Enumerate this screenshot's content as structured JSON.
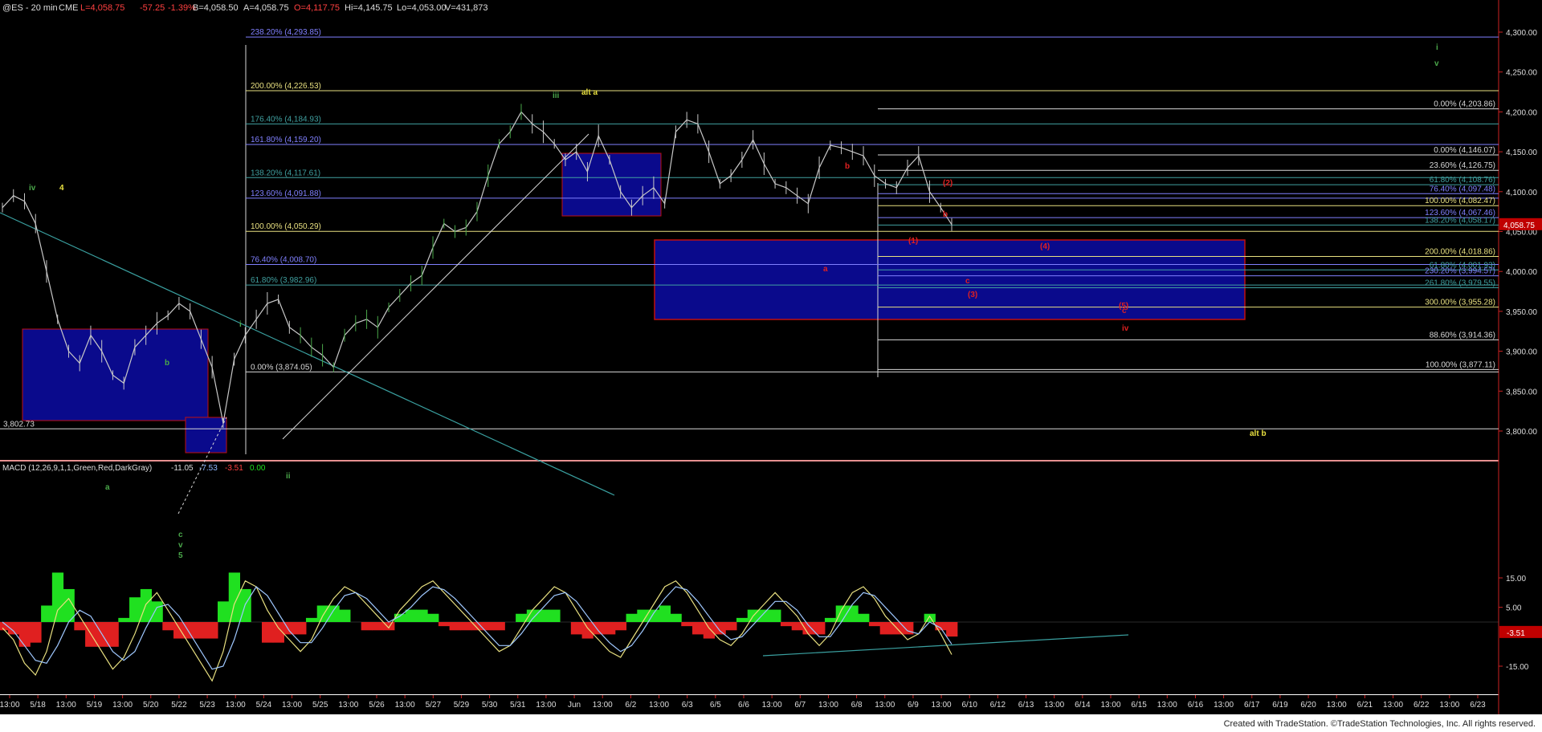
{
  "header": {
    "symbol": "@ES - 20 min",
    "exchange": "CME",
    "last": "L=4,058.75",
    "chg": "-57.25",
    "pct": "-1.39%",
    "bid": "B=4,058.50",
    "ask": "A=4,058.75",
    "open": "O=4,117.75",
    "high": "Hi=4,145.75",
    "low": "Lo=4,053.00",
    "volume": "V=431,873"
  },
  "macd_header": {
    "label": "MACD (12,26,9,1,1,Green,Red,DarkGray)",
    "macd": "-11.05",
    "signal": "-7.53",
    "hist": "-3.51",
    "zero": "0.00"
  },
  "footer": "Created with TradeStation. ©TradeStation Technologies, Inc. All rights reserved.",
  "colors": {
    "background": "#000000",
    "price_bar": "#c8c8c8",
    "up_leg": "#4aa84a",
    "box_fill": "#0a0a8c",
    "box_border_red": "#c01010",
    "fib_yellow": "#e8e080",
    "fib_white": "#d8d8d8",
    "fib_blue": "#8080ff",
    "fib_teal": "#40a0a0",
    "trendline": "#3aa0a0",
    "macd_pos": "#20e020",
    "macd_neg": "#e02020",
    "last_price_box": "#c00000"
  },
  "chart_data": [
    {
      "type": "line",
      "title": "",
      "ylim": [
        3775,
        4335
      ],
      "y_ticks": [
        "4,300.00",
        "4,250.00",
        "4,200.00",
        "4,150.00",
        "4,100.00",
        "4,050.00",
        "4,000.00",
        "3,950.00",
        "3,900.00",
        "3,850.00",
        "3,800.00"
      ],
      "y_tick_values": [
        4300,
        4250,
        4200,
        4150,
        4100,
        4050,
        4000,
        3950,
        3900,
        3850,
        3800
      ],
      "last_price": "4,058.75",
      "last_price_value": 4058.75,
      "x_labels": [
        "13:00",
        "5/18",
        "13:00",
        "5/19",
        "13:00",
        "5/20",
        "5/22",
        "5/23",
        "13:00",
        "5/24",
        "13:00",
        "5/25",
        "13:00",
        "5/26",
        "13:00",
        "5/27",
        "5/29",
        "5/30",
        "5/31",
        "13:00",
        "Jun",
        "13:00",
        "6/2",
        "13:00",
        "6/3",
        "6/5",
        "6/6",
        "13:00",
        "6/7",
        "13:00",
        "6/8",
        "13:00",
        "6/9",
        "13:00",
        "6/10",
        "6/12",
        "6/13",
        "13:00",
        "6/14",
        "13:00",
        "6/15",
        "13:00",
        "6/16",
        "13:00",
        "6/17",
        "6/19",
        "6/20",
        "13:00",
        "6/21",
        "13:00",
        "6/22",
        "13:00",
        "6/23"
      ],
      "series": [
        {
          "values": [
            4080,
            4095,
            4088,
            4060,
            4000,
            3940,
            3900,
            3885,
            3920,
            3900,
            3870,
            3860,
            3905,
            3920,
            3935,
            3945,
            3960,
            3950,
            3915,
            3880,
            3810,
            3890,
            3920,
            3940,
            3960,
            3965,
            3930,
            3920,
            3905,
            3895,
            3880,
            3920,
            3935,
            3940,
            3930,
            3955,
            3970,
            3985,
            3995,
            4030,
            4060,
            4050,
            4055,
            4075,
            4120,
            4160,
            4175,
            4200,
            4185,
            4175,
            4160,
            4140,
            4150,
            4125,
            4170,
            4140,
            4100,
            4080,
            4095,
            4105,
            4085,
            4175,
            4190,
            4185,
            4150,
            4110,
            4120,
            4140,
            4165,
            4135,
            4110,
            4105,
            4095,
            4085,
            4130,
            4158,
            4155,
            4150,
            4145,
            4120,
            4110,
            4105,
            4130,
            4145,
            4100,
            4080,
            4058.75
          ]
        }
      ],
      "fib_levels": [
        {
          "label": "238.20% (4,293.85)",
          "value": 4293.85,
          "color": "#8080ff",
          "side": "left"
        },
        {
          "label": "200.00% (4,226.53)",
          "value": 4226.53,
          "color": "#e8e080",
          "side": "left"
        },
        {
          "label": "176.40% (4,184.93)",
          "value": 4184.93,
          "color": "#40a0a0",
          "side": "left"
        },
        {
          "label": "161.80% (4,159.20)",
          "value": 4159.2,
          "color": "#8080ff",
          "side": "left"
        },
        {
          "label": "138.20% (4,117.61)",
          "value": 4117.61,
          "color": "#40a0a0",
          "side": "left"
        },
        {
          "label": "123.60% (4,091.88)",
          "value": 4091.88,
          "color": "#8080ff",
          "side": "left"
        },
        {
          "label": "100.00% (4,050.29)",
          "value": 4050.29,
          "color": "#e8e080",
          "side": "left"
        },
        {
          "label": "76.40% (4,008.70)",
          "value": 4008.7,
          "color": "#8080ff",
          "side": "left"
        },
        {
          "label": "61.80% (3,982.96)",
          "value": 3982.96,
          "color": "#40a0a0",
          "side": "left"
        },
        {
          "label": "0.00% (3,874.05)",
          "value": 3874.05,
          "color": "#d8d8d8",
          "side": "left"
        },
        {
          "label": "0.00% (4,203.86)",
          "value": 4203.86,
          "color": "#d8d8d8",
          "side": "right"
        },
        {
          "label": "0.00% (4,146.07)",
          "value": 4146.07,
          "color": "#d8d8d8",
          "side": "right"
        },
        {
          "label": "23.60% (4,126.75)",
          "value": 4126.75,
          "color": "#d8d8d8",
          "side": "right"
        },
        {
          "label": "61.80% (4,108.76)",
          "value": 4108.76,
          "color": "#40a0a0",
          "side": "right"
        },
        {
          "label": "76.40% (4,097.48)",
          "value": 4097.48,
          "color": "#8080ff",
          "side": "right"
        },
        {
          "label": "100.00% (4,082.47)",
          "value": 4082.47,
          "color": "#e8e080",
          "side": "right"
        },
        {
          "label": "123.60% (4,067.46)",
          "value": 4067.46,
          "color": "#8080ff",
          "side": "right"
        },
        {
          "label": "138.20% (4,058.17)",
          "value": 4058.17,
          "color": "#40a0a0",
          "side": "right"
        },
        {
          "label": "200.00% (4,018.86)",
          "value": 4018.86,
          "color": "#e8e080",
          "side": "right"
        },
        {
          "label": "61.80% (4,001.93)",
          "value": 4001.93,
          "color": "#40a0a0",
          "side": "right"
        },
        {
          "label": "230.20% (3,994.57)",
          "value": 3994.57,
          "color": "#8080ff",
          "side": "right"
        },
        {
          "label": "261.80% (3,979.55)",
          "value": 3979.55,
          "color": "#40a0a0",
          "side": "right"
        },
        {
          "label": "300.00% (3,955.28)",
          "value": 3955.28,
          "color": "#e8e080",
          "side": "right"
        },
        {
          "label": "88.60% (3,914.36)",
          "value": 3914.36,
          "color": "#d8d8d8",
          "side": "right"
        },
        {
          "label": "100.00% (3,877.11)",
          "value": 3877.11,
          "color": "#d8d8d8",
          "side": "right"
        }
      ],
      "horizontal_marks": [
        {
          "label": "3,802.73",
          "value": 3802.73
        }
      ],
      "wave_labels": [
        {
          "text": "iv",
          "color": "#4aa84a"
        },
        {
          "text": "4",
          "color": "#e8e040"
        },
        {
          "text": "b",
          "color": "#4aa84a"
        },
        {
          "text": "a",
          "color": "#4aa84a"
        },
        {
          "text": "i",
          "color": "#4aa84a"
        },
        {
          "text": "c",
          "color": "#4aa84a"
        },
        {
          "text": "v",
          "color": "#4aa84a"
        },
        {
          "text": "5",
          "color": "#4aa84a"
        },
        {
          "text": "ii",
          "color": "#4aa84a"
        },
        {
          "text": "iii",
          "color": "#4aa84a"
        },
        {
          "text": "alt a",
          "color": "#e8e040"
        },
        {
          "text": "b",
          "color": "#e02020"
        },
        {
          "text": "a",
          "color": "#e02020"
        },
        {
          "text": "(2)",
          "color": "#e02020"
        },
        {
          "text": "(1)",
          "color": "#e02020"
        },
        {
          "text": "b",
          "color": "#e02020"
        },
        {
          "text": "c",
          "color": "#e02020"
        },
        {
          "text": "(3)",
          "color": "#e02020"
        },
        {
          "text": "(4)",
          "color": "#e02020"
        },
        {
          "text": "(5)",
          "color": "#e02020"
        },
        {
          "text": "c",
          "color": "#e02020"
        },
        {
          "text": "iv",
          "color": "#e02020"
        },
        {
          "text": "alt b",
          "color": "#e8e040"
        },
        {
          "text": "i",
          "color": "#4aa84a"
        },
        {
          "text": "v",
          "color": "#4aa84a"
        }
      ]
    },
    {
      "type": "bar",
      "title": "MACD",
      "ylim": [
        -20,
        20
      ],
      "y_ticks": [
        "15.00",
        "5.00",
        "-15.00"
      ],
      "y_tick_values": [
        15,
        5,
        -15
      ],
      "last_value_label": "-3.51",
      "series": [
        {
          "name": "MACD",
          "values": [
            -2,
            -6,
            -14,
            -18,
            -10,
            4,
            8,
            2,
            -4,
            -10,
            -16,
            -12,
            -4,
            6,
            10,
            4,
            -2,
            -8,
            -14,
            -20,
            -10,
            6,
            14,
            12,
            4,
            -2,
            -6,
            -10,
            -6,
            2,
            8,
            12,
            10,
            6,
            2,
            -2,
            4,
            8,
            12,
            14,
            10,
            6,
            2,
            -2,
            -6,
            -10,
            -8,
            -2,
            4,
            8,
            12,
            10,
            4,
            -2,
            -6,
            -10,
            -12,
            -6,
            0,
            6,
            12,
            14,
            10,
            4,
            -2,
            -6,
            -8,
            -4,
            2,
            6,
            10,
            6,
            2,
            -4,
            -8,
            -4,
            4,
            10,
            12,
            8,
            2,
            -2,
            -6,
            -4,
            2,
            -4,
            -11.05
          ]
        },
        {
          "name": "Signal",
          "values": [
            0,
            -3,
            -8,
            -13,
            -14,
            -8,
            0,
            4,
            2,
            -4,
            -10,
            -13,
            -10,
            -2,
            5,
            6,
            2,
            -4,
            -10,
            -16,
            -15,
            -6,
            6,
            12,
            9,
            3,
            -3,
            -7,
            -7,
            -2,
            4,
            9,
            10,
            8,
            4,
            0,
            2,
            5,
            9,
            12,
            11,
            8,
            4,
            0,
            -4,
            -8,
            -8,
            -4,
            1,
            5,
            9,
            10,
            7,
            2,
            -3,
            -7,
            -10,
            -8,
            -3,
            3,
            8,
            12,
            11,
            7,
            2,
            -3,
            -6,
            -5,
            -1,
            3,
            7,
            7,
            4,
            -1,
            -5,
            -5,
            0,
            6,
            10,
            9,
            5,
            1,
            -3,
            -4,
            0,
            -2,
            -7.53
          ]
        }
      ]
    }
  ]
}
